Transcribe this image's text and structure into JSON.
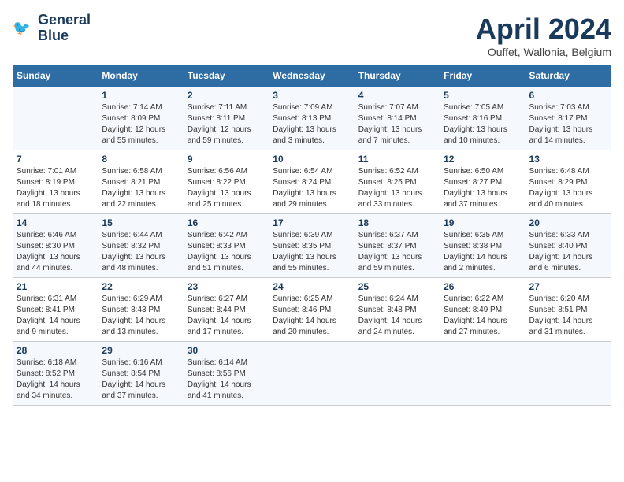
{
  "header": {
    "logo_line1": "General",
    "logo_line2": "Blue",
    "month": "April 2024",
    "location": "Ouffet, Wallonia, Belgium"
  },
  "weekdays": [
    "Sunday",
    "Monday",
    "Tuesday",
    "Wednesday",
    "Thursday",
    "Friday",
    "Saturday"
  ],
  "weeks": [
    [
      {
        "day": "",
        "info": ""
      },
      {
        "day": "1",
        "info": "Sunrise: 7:14 AM\nSunset: 8:09 PM\nDaylight: 12 hours\nand 55 minutes."
      },
      {
        "day": "2",
        "info": "Sunrise: 7:11 AM\nSunset: 8:11 PM\nDaylight: 12 hours\nand 59 minutes."
      },
      {
        "day": "3",
        "info": "Sunrise: 7:09 AM\nSunset: 8:13 PM\nDaylight: 13 hours\nand 3 minutes."
      },
      {
        "day": "4",
        "info": "Sunrise: 7:07 AM\nSunset: 8:14 PM\nDaylight: 13 hours\nand 7 minutes."
      },
      {
        "day": "5",
        "info": "Sunrise: 7:05 AM\nSunset: 8:16 PM\nDaylight: 13 hours\nand 10 minutes."
      },
      {
        "day": "6",
        "info": "Sunrise: 7:03 AM\nSunset: 8:17 PM\nDaylight: 13 hours\nand 14 minutes."
      }
    ],
    [
      {
        "day": "7",
        "info": "Sunrise: 7:01 AM\nSunset: 8:19 PM\nDaylight: 13 hours\nand 18 minutes."
      },
      {
        "day": "8",
        "info": "Sunrise: 6:58 AM\nSunset: 8:21 PM\nDaylight: 13 hours\nand 22 minutes."
      },
      {
        "day": "9",
        "info": "Sunrise: 6:56 AM\nSunset: 8:22 PM\nDaylight: 13 hours\nand 25 minutes."
      },
      {
        "day": "10",
        "info": "Sunrise: 6:54 AM\nSunset: 8:24 PM\nDaylight: 13 hours\nand 29 minutes."
      },
      {
        "day": "11",
        "info": "Sunrise: 6:52 AM\nSunset: 8:25 PM\nDaylight: 13 hours\nand 33 minutes."
      },
      {
        "day": "12",
        "info": "Sunrise: 6:50 AM\nSunset: 8:27 PM\nDaylight: 13 hours\nand 37 minutes."
      },
      {
        "day": "13",
        "info": "Sunrise: 6:48 AM\nSunset: 8:29 PM\nDaylight: 13 hours\nand 40 minutes."
      }
    ],
    [
      {
        "day": "14",
        "info": "Sunrise: 6:46 AM\nSunset: 8:30 PM\nDaylight: 13 hours\nand 44 minutes."
      },
      {
        "day": "15",
        "info": "Sunrise: 6:44 AM\nSunset: 8:32 PM\nDaylight: 13 hours\nand 48 minutes."
      },
      {
        "day": "16",
        "info": "Sunrise: 6:42 AM\nSunset: 8:33 PM\nDaylight: 13 hours\nand 51 minutes."
      },
      {
        "day": "17",
        "info": "Sunrise: 6:39 AM\nSunset: 8:35 PM\nDaylight: 13 hours\nand 55 minutes."
      },
      {
        "day": "18",
        "info": "Sunrise: 6:37 AM\nSunset: 8:37 PM\nDaylight: 13 hours\nand 59 minutes."
      },
      {
        "day": "19",
        "info": "Sunrise: 6:35 AM\nSunset: 8:38 PM\nDaylight: 14 hours\nand 2 minutes."
      },
      {
        "day": "20",
        "info": "Sunrise: 6:33 AM\nSunset: 8:40 PM\nDaylight: 14 hours\nand 6 minutes."
      }
    ],
    [
      {
        "day": "21",
        "info": "Sunrise: 6:31 AM\nSunset: 8:41 PM\nDaylight: 14 hours\nand 9 minutes."
      },
      {
        "day": "22",
        "info": "Sunrise: 6:29 AM\nSunset: 8:43 PM\nDaylight: 14 hours\nand 13 minutes."
      },
      {
        "day": "23",
        "info": "Sunrise: 6:27 AM\nSunset: 8:44 PM\nDaylight: 14 hours\nand 17 minutes."
      },
      {
        "day": "24",
        "info": "Sunrise: 6:25 AM\nSunset: 8:46 PM\nDaylight: 14 hours\nand 20 minutes."
      },
      {
        "day": "25",
        "info": "Sunrise: 6:24 AM\nSunset: 8:48 PM\nDaylight: 14 hours\nand 24 minutes."
      },
      {
        "day": "26",
        "info": "Sunrise: 6:22 AM\nSunset: 8:49 PM\nDaylight: 14 hours\nand 27 minutes."
      },
      {
        "day": "27",
        "info": "Sunrise: 6:20 AM\nSunset: 8:51 PM\nDaylight: 14 hours\nand 31 minutes."
      }
    ],
    [
      {
        "day": "28",
        "info": "Sunrise: 6:18 AM\nSunset: 8:52 PM\nDaylight: 14 hours\nand 34 minutes."
      },
      {
        "day": "29",
        "info": "Sunrise: 6:16 AM\nSunset: 8:54 PM\nDaylight: 14 hours\nand 37 minutes."
      },
      {
        "day": "30",
        "info": "Sunrise: 6:14 AM\nSunset: 8:56 PM\nDaylight: 14 hours\nand 41 minutes."
      },
      {
        "day": "",
        "info": ""
      },
      {
        "day": "",
        "info": ""
      },
      {
        "day": "",
        "info": ""
      },
      {
        "day": "",
        "info": ""
      }
    ]
  ]
}
